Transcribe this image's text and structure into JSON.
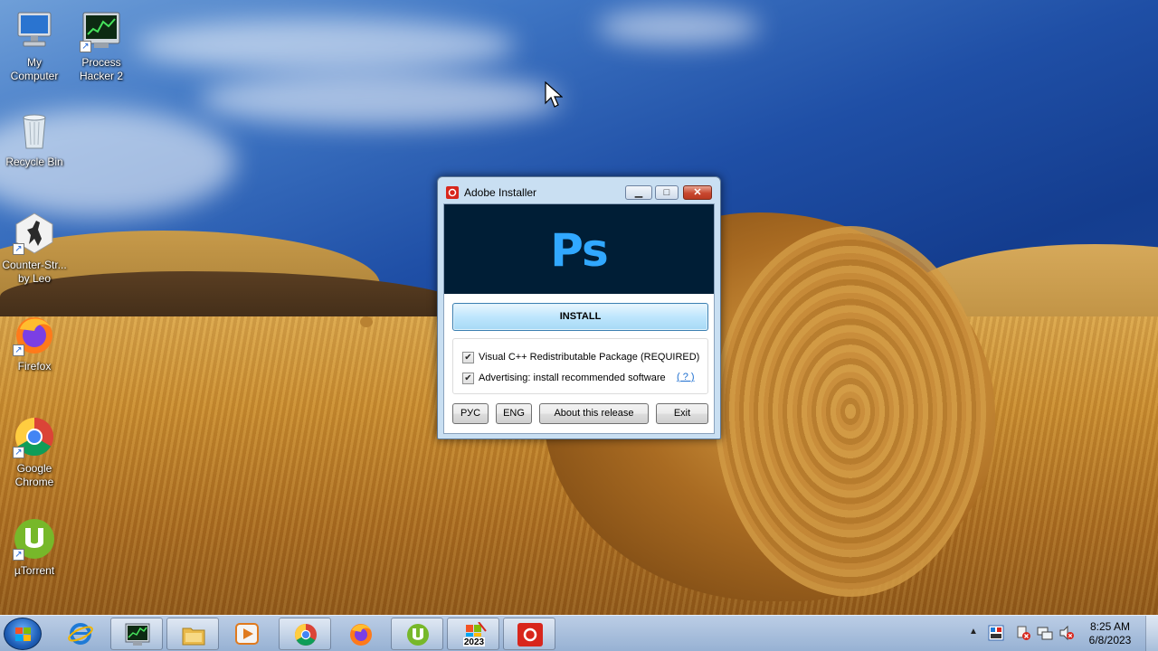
{
  "desktop": {
    "icons": [
      {
        "label_line1": "My",
        "label_line2": "Computer",
        "icon": "computer-icon"
      },
      {
        "label_line1": "Process",
        "label_line2": "Hacker 2",
        "icon": "process-hacker-icon"
      },
      {
        "label_line1": "Recycle Bin",
        "label_line2": "",
        "icon": "recycle-bin-icon"
      },
      {
        "label_line1": "Counter-Str...",
        "label_line2": "by Leo",
        "icon": "counter-strike-icon"
      },
      {
        "label_line1": "Firefox",
        "label_line2": "",
        "icon": "firefox-icon"
      },
      {
        "label_line1": "Google",
        "label_line2": "Chrome",
        "icon": "chrome-icon"
      },
      {
        "label_line1": "µTorrent",
        "label_line2": "",
        "icon": "utorrent-icon"
      }
    ]
  },
  "installer": {
    "title": "Adobe Installer",
    "logo_text": "Ps",
    "install_label": "INSTALL",
    "options": [
      {
        "label": "Visual C++ Redistributable Package (REQUIRED)",
        "checked": true
      },
      {
        "label": "Advertising: install recommended software",
        "checked": true
      }
    ],
    "help_link": "( ? )",
    "buttons": {
      "rus": "РУС",
      "eng": "ENG",
      "about": "About this release",
      "exit": "Exit"
    },
    "colors": {
      "banner": "#001e36",
      "ps_blue": "#31a8ff"
    }
  },
  "taskbar": {
    "pinned": [
      "internet-explorer-icon",
      "process-hacker-icon",
      "file-explorer-icon",
      "media-player-icon",
      "chrome-icon",
      "firefox-icon",
      "utorrent-icon",
      "installer-2023-icon",
      "adobe-creative-cloud-icon"
    ],
    "calendar_badge": "2023",
    "clock_time": "8:25 AM",
    "clock_date": "6/8/2023"
  }
}
